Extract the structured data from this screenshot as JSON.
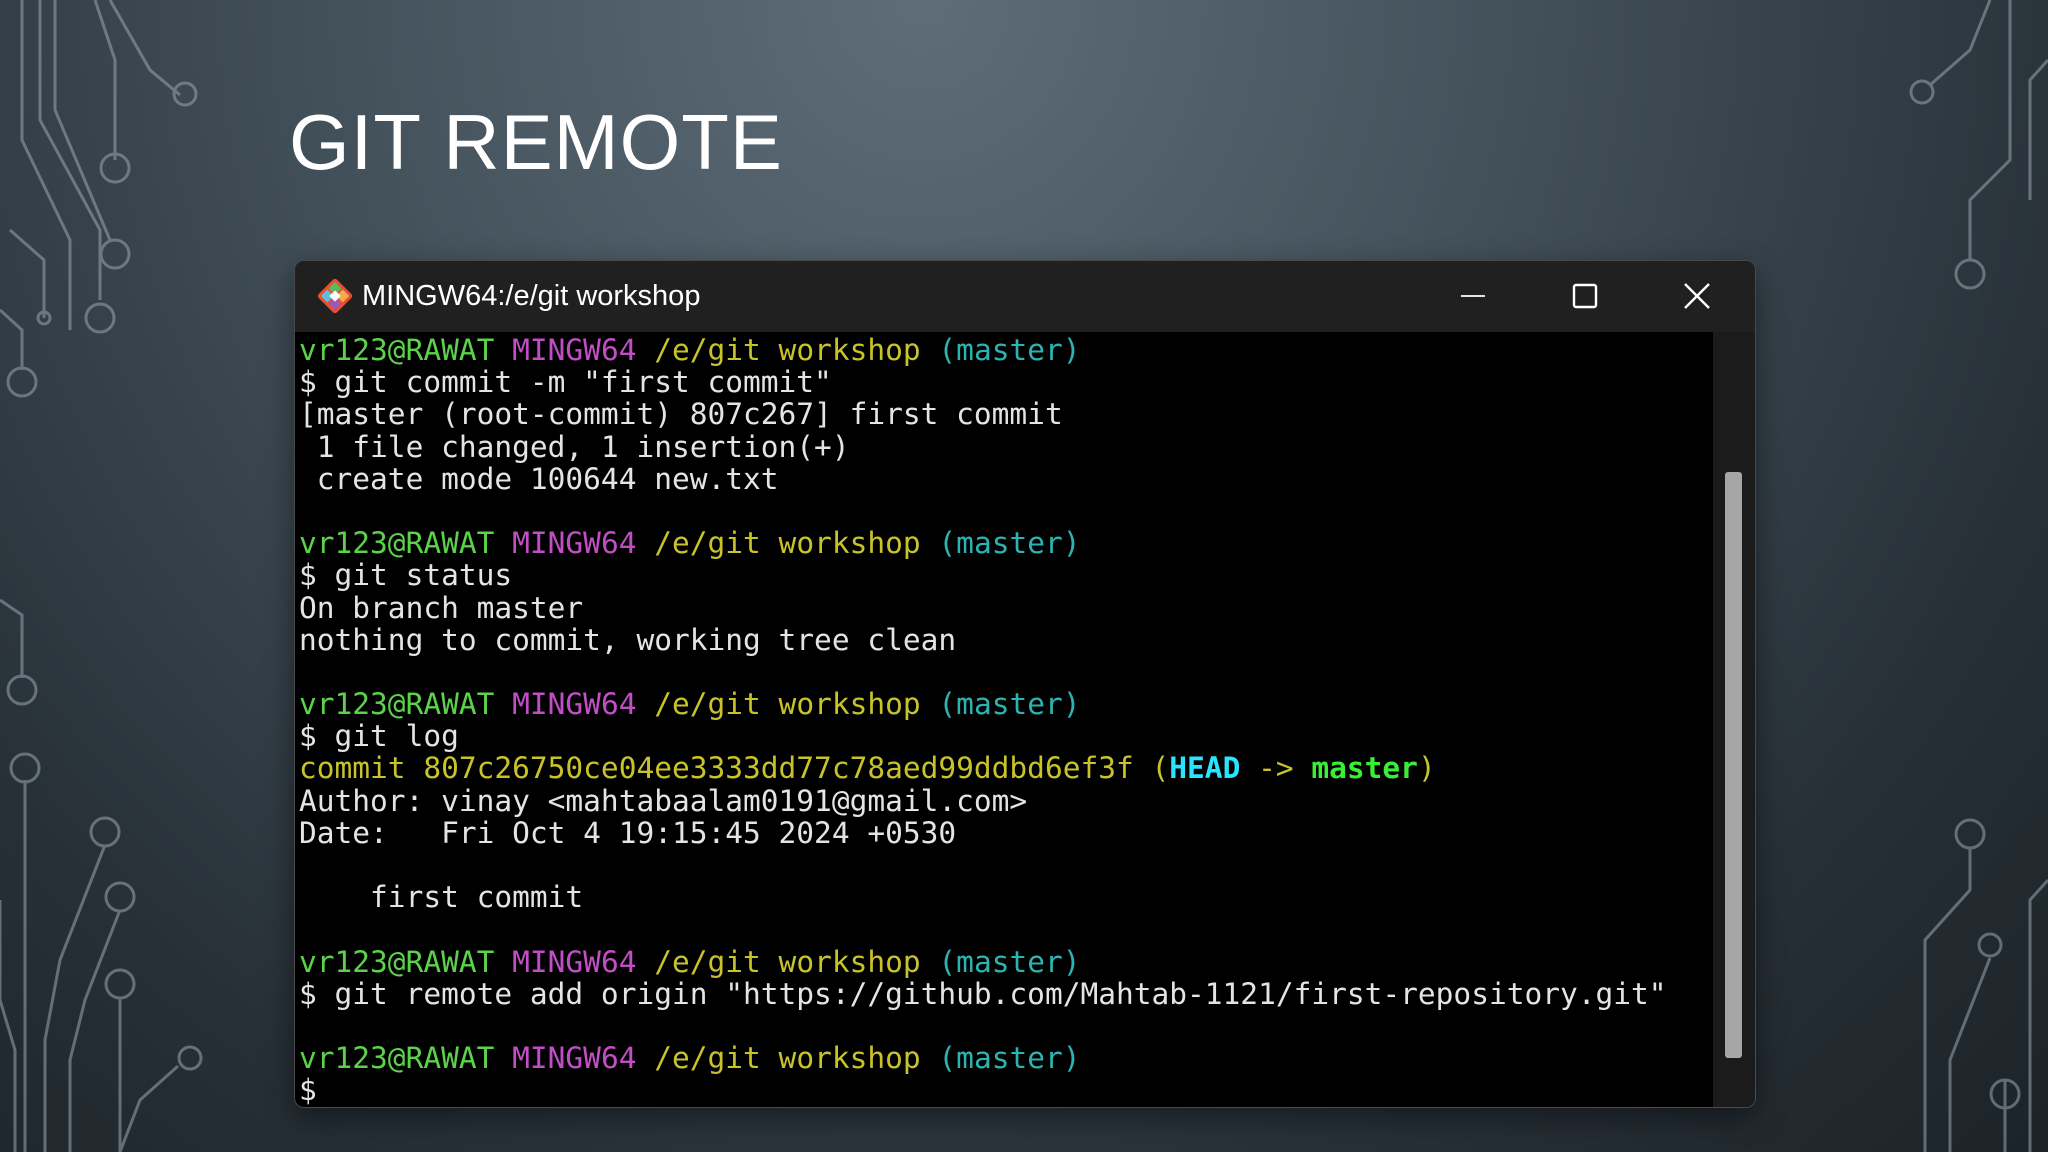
{
  "slide": {
    "title": "GIT REMOTE"
  },
  "window": {
    "title": "MINGW64:/e/git workshop",
    "icon": "git-bash-icon",
    "controls": {
      "minimize": "minimize-icon",
      "maximize": "maximize-icon",
      "close": "close-icon"
    }
  },
  "colors": {
    "user_host": "#5bd24a",
    "mingw": "#c14ec5",
    "path": "#c9c32a",
    "branch": "#2bb5b2",
    "head": "#27e5ff",
    "master_ref": "#39ef36",
    "text": "#e4e4e4"
  },
  "terminal": {
    "prompt": {
      "user_host": "vr123@RAWAT",
      "shell": "MINGW64",
      "path": "/e/git workshop",
      "branch": "(master)"
    },
    "cmd_commit": "$ git commit -m \"first commit\"",
    "out_commit_1": "[master (root-commit) 807c267] first commit",
    "out_commit_2": " 1 file changed, 1 insertion(+)",
    "out_commit_3": " create mode 100644 new.txt",
    "cmd_status": "$ git status",
    "out_status_1": "On branch master",
    "out_status_2": "nothing to commit, working tree clean",
    "cmd_log": "$ git log",
    "log_commit_hash": "commit 807c26750ce04ee3333dd77c78aed99ddbd6ef3f",
    "log_open_paren": "(",
    "log_head": "HEAD",
    "log_arrow": " -> ",
    "log_master": "master",
    "log_close_paren": ")",
    "log_author": "Author: vinay <mahtabaalam0191@gmail.com>",
    "log_date": "Date:   Fri Oct 4 19:15:45 2024 +0530",
    "log_message": "    first commit",
    "cmd_remote": "$ git remote add origin \"https://github.com/Mahtab-1121/first-repository.git\"",
    "cursor_prompt": "$"
  }
}
